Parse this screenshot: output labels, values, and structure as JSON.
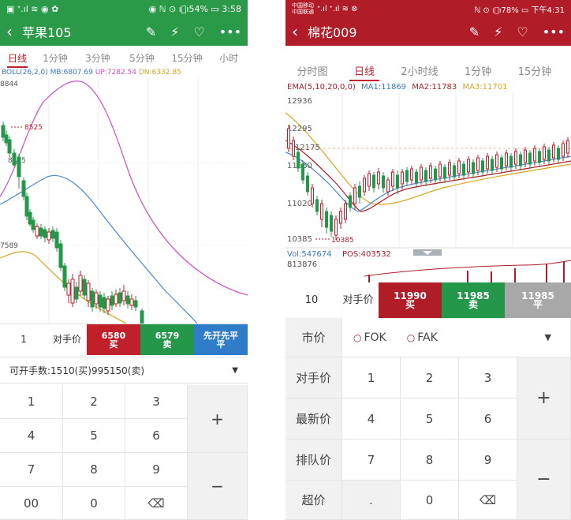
{
  "left": {
    "status": {
      "left": "▣ ᐩ.ıl ≋ ◉ ✿",
      "right": "◉ ℕ ⊙ ı⃞ı54% ▭ 3:58"
    },
    "title": "苹果105",
    "tabs": [
      "日线",
      "1分钟",
      "3分钟",
      "5分钟",
      "15分钟",
      "小时"
    ],
    "active_tab": 0,
    "legend": {
      "boll": "BOLL(26,2,0)",
      "mb": "MB:6807.69",
      "up": "UP:7282.54",
      "dn": "DN:6332.85"
    },
    "axis_labels": {
      "high": "8844",
      "mid1": "8525",
      "mid2": "8215",
      "low": "7589"
    },
    "order": {
      "qty": "1",
      "price_type": "对手价",
      "buy_price": "6580",
      "buy_label": "买",
      "sell_price": "6579",
      "sell_label": "卖",
      "close_top": "先开先平",
      "close_bottom": "平"
    },
    "info": "可开手数:1510(买)995150(卖)",
    "keys": [
      "1",
      "2",
      "3",
      "4",
      "5",
      "6",
      "7",
      "8",
      "9",
      "00",
      "0"
    ],
    "plus": "+",
    "minus": "−",
    "colors": {
      "header": "#2a9a48",
      "buy": "#c0202a",
      "sell": "#25974a",
      "close": "#2f7cc8"
    }
  },
  "right": {
    "status": {
      "left_top": "中国移动 ",
      "left_bottom": "中国联通",
      "signal": "ᐩ.ıl ᐩ.ıl ≋ ⊗",
      "right": "ℕ ⊙ ı⃞ı78% ▭ 下午4:31"
    },
    "title": "棉花009",
    "tabs": [
      "分时图",
      "日线",
      "2小时线",
      "1分钟",
      "15分钟"
    ],
    "active_tab": 1,
    "legend": {
      "ema": "EMA(5,10,20,0,0)",
      "ma1": "MA1:11869",
      "ma2": "MA2:11783",
      "ma3": "MA3:11701"
    },
    "axis_labels": {
      "high": "12936",
      "l2": "12295",
      "l3": "12175",
      "l4": "11660",
      "l5": "11020",
      "low": "10385",
      "low_marker": "10385"
    },
    "vol": {
      "vol": "Vol:547674",
      "pos": "POS:403532",
      "max": "813876"
    },
    "order": {
      "qty": "10",
      "price_type": "对手价",
      "buy_price": "11990",
      "buy_label": "买",
      "sell_price": "11985",
      "sell_label": "卖",
      "close_price": "11985",
      "close_label": "平"
    },
    "price_options": {
      "market": "市价",
      "fok": "FOK",
      "fak": "FAK"
    },
    "side_labels": [
      "对手价",
      "最新价",
      "排队价",
      "超价"
    ],
    "keys": [
      "1",
      "2",
      "3",
      "4",
      "5",
      "6",
      "7",
      "8",
      "9",
      ".",
      "0"
    ],
    "plus": "+",
    "minus": "−",
    "colors": {
      "header": "#b01c28",
      "buy": "#b01c28",
      "sell": "#25974a",
      "close": "#a8a8a8"
    }
  }
}
